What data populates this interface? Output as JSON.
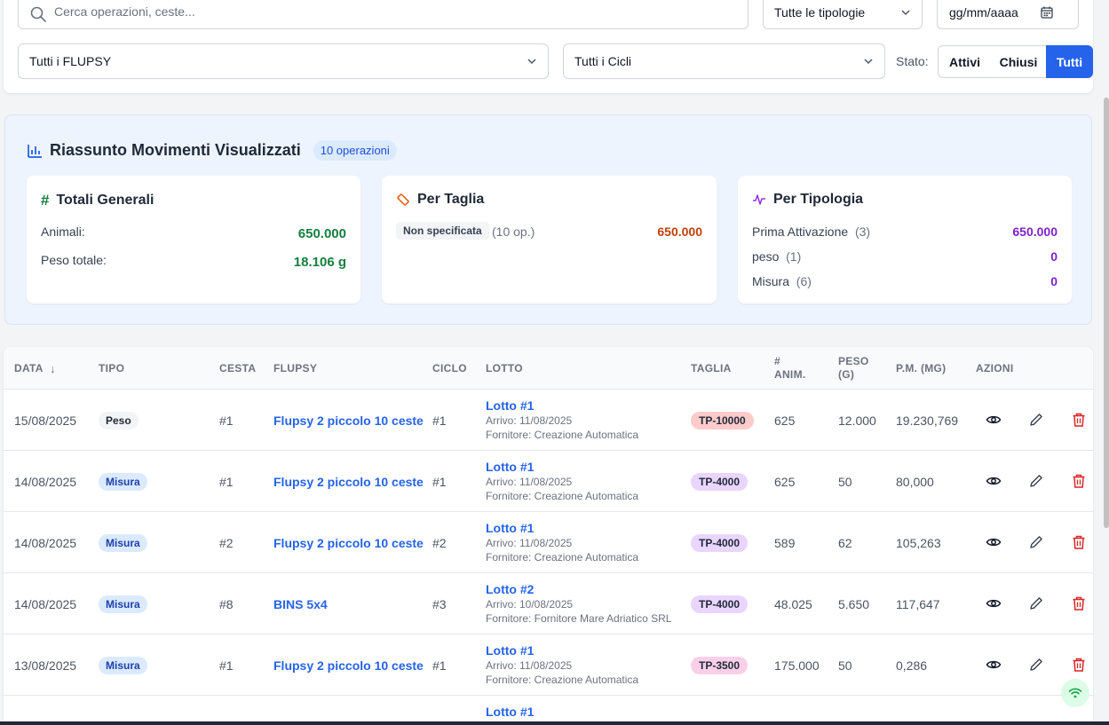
{
  "filters": {
    "search_placeholder": "Cerca operazioni, ceste...",
    "tipologia": "Tutte le tipologie",
    "date_placeholder": "gg/mm/aaaa",
    "flupsy": "Tutti i FLUPSY",
    "cicli": "Tutti i Cicli",
    "stato_label": "Stato:",
    "stato_options": [
      "Attivi",
      "Chiusi",
      "Tutti"
    ],
    "stato_selected": "Tutti"
  },
  "summary": {
    "title": "Riassunto Movimenti Visualizzati",
    "ops_badge": "10 operazioni",
    "totali": {
      "title": "Totali Generali",
      "animali_label": "Animali:",
      "animali_value": "650.000",
      "peso_label": "Peso totale:",
      "peso_value": "18.106 g"
    },
    "taglia": {
      "title": "Per Taglia",
      "size_label": "Non specificata",
      "size_count": "(10 op.)",
      "size_value": "650.000"
    },
    "tipologia": {
      "title": "Per Tipologia",
      "rows": [
        {
          "label": "Prima Attivazione",
          "count": "(3)",
          "value": "650.000"
        },
        {
          "label": "peso",
          "count": "(1)",
          "value": "0"
        },
        {
          "label": "Misura",
          "count": "(6)",
          "value": "0"
        }
      ]
    }
  },
  "table": {
    "headers": {
      "data": "DATA",
      "tipo": "TIPO",
      "cesta": "CESTA",
      "flupsy": "FLUPSY",
      "ciclo": "CICLO",
      "lotto": "LOTTO",
      "taglia": "TAGLIA",
      "anim_1": "#",
      "anim_2": "ANIM.",
      "peso_1": "PESO",
      "peso_2": "(G)",
      "pm": "P.M. (MG)",
      "azioni": "AZIONI"
    },
    "rows": [
      {
        "data": "15/08/2025",
        "tipo": "Peso",
        "cesta": "#1",
        "flupsy": "Flupsy 2 piccolo 10 ceste",
        "ciclo": "#1",
        "lotto": "Lotto #1",
        "arrivo": "Arrivo: 11/08/2025",
        "fornitore": "Fornitore: Creazione Automatica",
        "taglia": "TP-10000",
        "animali": "625",
        "peso": "12.000",
        "pm": "19.230,769"
      },
      {
        "data": "14/08/2025",
        "tipo": "Misura",
        "cesta": "#1",
        "flupsy": "Flupsy 2 piccolo 10 ceste",
        "ciclo": "#1",
        "lotto": "Lotto #1",
        "arrivo": "Arrivo: 11/08/2025",
        "fornitore": "Fornitore: Creazione Automatica",
        "taglia": "TP-4000",
        "animali": "625",
        "peso": "50",
        "pm": "80,000"
      },
      {
        "data": "14/08/2025",
        "tipo": "Misura",
        "cesta": "#2",
        "flupsy": "Flupsy 2 piccolo 10 ceste",
        "ciclo": "#2",
        "lotto": "Lotto #1",
        "arrivo": "Arrivo: 11/08/2025",
        "fornitore": "Fornitore: Creazione Automatica",
        "taglia": "TP-4000",
        "animali": "589",
        "peso": "62",
        "pm": "105,263"
      },
      {
        "data": "14/08/2025",
        "tipo": "Misura",
        "cesta": "#8",
        "flupsy": "BINS 5x4",
        "ciclo": "#3",
        "lotto": "Lotto #2",
        "arrivo": "Arrivo: 10/08/2025",
        "fornitore": "Fornitore: Fornitore Mare Adriatico SRL",
        "taglia": "TP-4000",
        "animali": "48.025",
        "peso": "5.650",
        "pm": "117,647"
      },
      {
        "data": "13/08/2025",
        "tipo": "Misura",
        "cesta": "#1",
        "flupsy": "Flupsy 2 piccolo 10 ceste",
        "ciclo": "#1",
        "lotto": "Lotto #1",
        "arrivo": "Arrivo: 11/08/2025",
        "fornitore": "Fornitore: Creazione Automatica",
        "taglia": "TP-3500",
        "animali": "175.000",
        "peso": "50",
        "pm": "0,286"
      },
      {
        "lotto": "Lotto #1"
      }
    ]
  },
  "colors": {
    "accent": "#2563eb",
    "green": "#15803d",
    "orange": "#c2410c",
    "purple": "#7e22ce",
    "delete": "#dc2626",
    "taglia_10000": "#fecaca",
    "taglia_4000": "#e9d5ff",
    "taglia_3500": "#fbcfe8"
  }
}
